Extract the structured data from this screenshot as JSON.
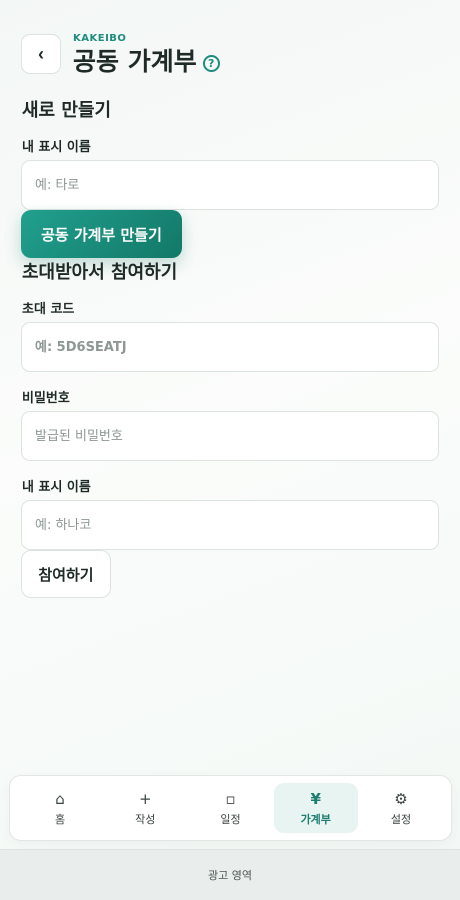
{
  "header": {
    "back_icon": "chevron-left-icon",
    "back_glyph": "‹",
    "brand": "KAKEIBO",
    "title": "공동 가계부",
    "help_glyph": "?"
  },
  "create_section": {
    "title": "새로 만들기",
    "name_label": "내 표시 이름",
    "name_placeholder": "예: 타로",
    "create_button": "공동 가계부 만들기"
  },
  "join_section": {
    "title": "초대받아서 참여하기",
    "code_label": "초대 코드",
    "code_placeholder": "예: 5D6SEATJ",
    "password_label": "비밀번호",
    "password_placeholder": "발급된 비밀번호",
    "name_label": "내 표시 이름",
    "name_placeholder": "예: 하나코",
    "join_button": "참여하기"
  },
  "nav": {
    "items": [
      {
        "label": "홈",
        "icon": "home-icon",
        "glyph": "⌂",
        "active": false
      },
      {
        "label": "작성",
        "icon": "plus-icon",
        "glyph": "+",
        "active": false
      },
      {
        "label": "일정",
        "icon": "calendar-icon",
        "glyph": "▫",
        "active": false
      },
      {
        "label": "가계부",
        "icon": "yen-icon",
        "glyph": "¥",
        "active": true
      },
      {
        "label": "설정",
        "icon": "gear-icon",
        "glyph": "⚙",
        "active": false
      }
    ]
  },
  "ad": {
    "label": "광고 영역"
  },
  "colors": {
    "accent": "#1e8c7e",
    "accent_dark": "#137867",
    "active_bg": "#e7f4f1"
  }
}
